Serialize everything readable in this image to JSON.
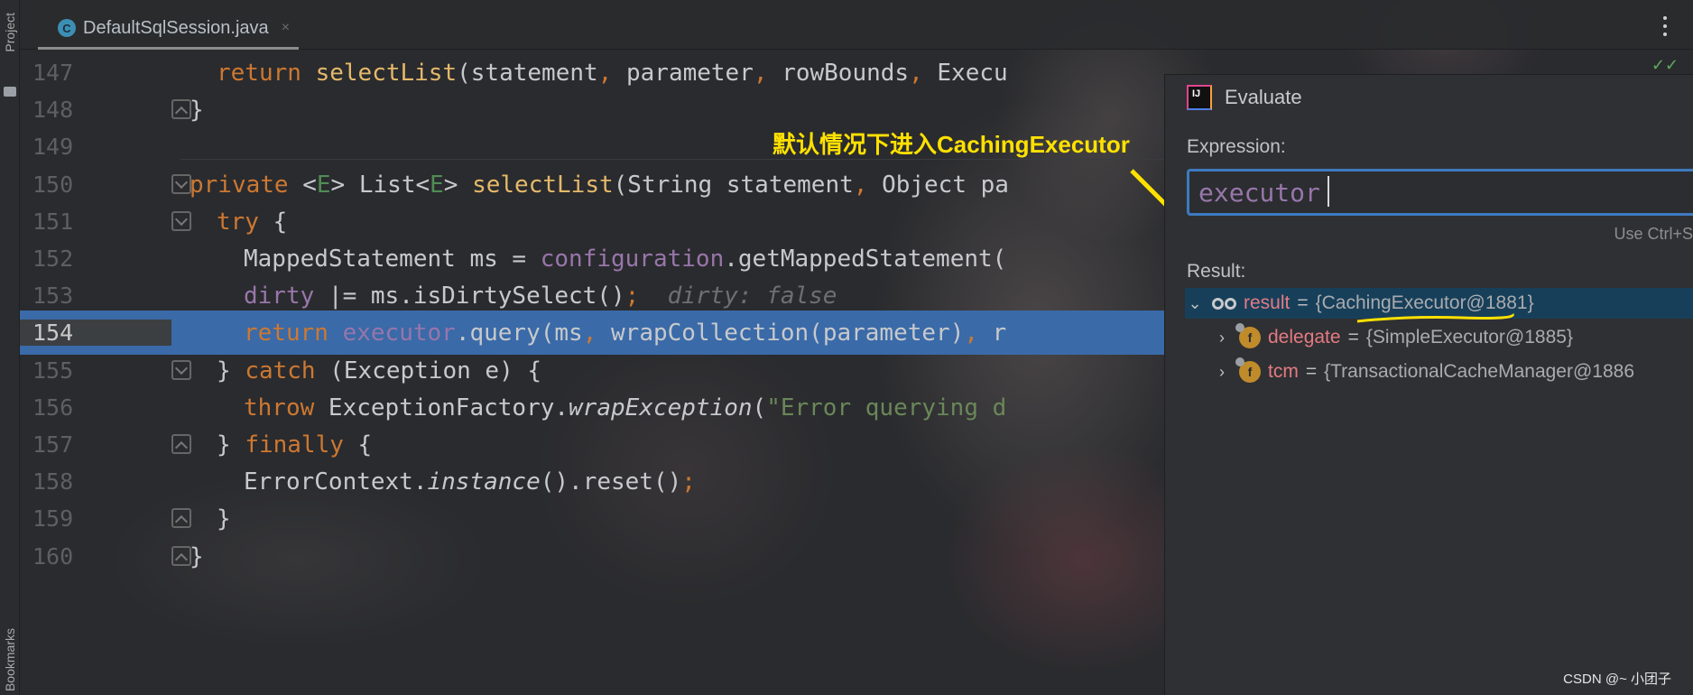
{
  "sidebar": {
    "project_label": "Project",
    "bookmarks_label": "Bookmarks"
  },
  "tab": {
    "icon_letter": "C",
    "title": "DefaultSqlSession.java",
    "close_glyph": "×"
  },
  "editor": {
    "current_line": 154,
    "lines": [
      {
        "no": "147",
        "text": "return selectList(statement, parameter, rowBounds, Execu"
      },
      {
        "no": "148",
        "text": "}"
      },
      {
        "no": "149",
        "text": ""
      },
      {
        "no": "150",
        "text": "private <E> List<E> selectList(String statement, Object pa"
      },
      {
        "no": "151",
        "text": "try {"
      },
      {
        "no": "152",
        "text": "MappedStatement ms = configuration.getMappedStatement("
      },
      {
        "no": "153",
        "text": "dirty |= ms.isDirtySelect();",
        "hint": "dirty: false"
      },
      {
        "no": "154",
        "text": "return executor.query(ms, wrapCollection(parameter), r"
      },
      {
        "no": "155",
        "text": "} catch (Exception e) {"
      },
      {
        "no": "156",
        "text": "throw ExceptionFactory.wrapException(\"Error querying d"
      },
      {
        "no": "157",
        "text": "} finally {"
      },
      {
        "no": "158",
        "text": "ErrorContext.instance().reset();"
      },
      {
        "no": "159",
        "text": "}"
      },
      {
        "no": "160",
        "text": "}"
      }
    ]
  },
  "annotation": {
    "text": "默认情况下进入CachingExecutor",
    "color": "#ffe100"
  },
  "evaluate": {
    "title": "Evaluate",
    "expression_label": "Expression:",
    "expression_value": "executor",
    "use_hint": "Use Ctrl+S",
    "result_label": "Result:",
    "tree": [
      {
        "name": "result",
        "value": "{CachingExecutor@1881}",
        "icon": "watch-icon",
        "expanded": true,
        "selected": true
      },
      {
        "name": "delegate",
        "value": "{SimpleExecutor@1885}",
        "icon": "field-icon",
        "expanded": false
      },
      {
        "name": "tcm",
        "value": "{TransactionalCacheManager@1886",
        "icon": "field-icon",
        "expanded": false
      }
    ]
  },
  "watermark": "CSDN @~ 小团子",
  "colors": {
    "selection": "#3a6aa8",
    "keyword": "#cc7832",
    "field": "#9876aa",
    "string": "#6a8759",
    "var_name": "#e47a82"
  }
}
